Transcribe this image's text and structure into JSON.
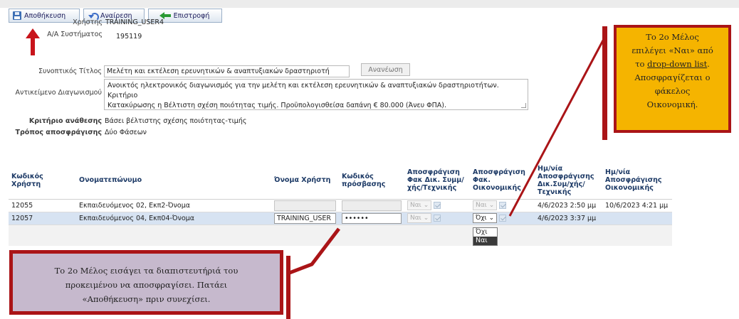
{
  "toolbar": {
    "save_label": "Αποθήκευση",
    "cancel_label": "Αναίρεση",
    "back_label": "Επιστροφή"
  },
  "form": {
    "user_label": "Χρήστης",
    "user_value": "TRAINING_USER4",
    "system_no_label": "Α/Α Συστήματος",
    "system_no_value": "195119",
    "short_title_label": "Συνοπτικός Τίτλος",
    "short_title_value": "Μελέτη και εκτέλεση ερευνητικών & αναπτυξιακών δραστηριοτή",
    "refresh_label": "Ανανέωση",
    "subject_label": "Αντικείμενο Διαγωνισμού",
    "subject_line1": "Ανοικτός ηλεκτρονικός διαγωνισμός για την  μελέτη και εκτέλεση ερευνητικών & αναπτυξιακών δραστηριοτήτων. Κριτήριο",
    "subject_line2": "Κατακύρωσης η Βέλτιστη σχέση ποιότητας τιμής. Προϋπολογισθείσα δαπάνη € 80.000 (Άνευ ΦΠΑ).",
    "award_label": "Κριτήριο ανάθεσης",
    "award_value": "Βάσει βέλτιστης σχέσης ποιότητας-τιμής",
    "unseal_label": "Τρόπος αποσφράγισης",
    "unseal_value": "Δύο Φάσεων"
  },
  "table": {
    "headers": {
      "user_code": "Κωδικός Χρήστη",
      "fullname": "Ονοματεπώνυμο",
      "username": "Όνομα Χρήστη",
      "password": "Κωδικός πρόσβασης",
      "tech_unseal": "Αποσφράγιση Φακ Δικ. Συμμ/χής/Τεχνικής",
      "fin_unseal": "Αποσφράγιση Φακ. Οικονομικής",
      "tech_date": "Ημ/νία Αποσφράγισης Δικ.Συμ/χής/Τεχνικής",
      "fin_date": "Ημ/νία Αποσφράγισης Οικονομικής"
    },
    "rows": [
      {
        "user_code": "12055",
        "fullname": "Εκπαιδευόμενος 02, Εκπ2-Όνομα",
        "username": "",
        "password": "",
        "tech_select": "Ναι",
        "fin_select": "Ναι",
        "tech_date": "4/6/2023 2:50 μμ",
        "fin_date": "10/6/2023 4:21 μμ"
      },
      {
        "user_code": "12057",
        "fullname": "Εκπαιδευόμενος 04, Εκπ04-Όνομα",
        "username": "TRAINING_USER",
        "password": "••••••",
        "tech_select": "Ναι",
        "fin_select": "Όχι",
        "tech_date": "4/6/2023 3:37 μμ",
        "fin_date": ""
      }
    ],
    "dropdown_options": [
      "Όχι",
      "Ναι"
    ]
  },
  "callouts": {
    "right": {
      "line1": "Το 2ο Μέλος",
      "line2": "επιλέγει «Ναι» από",
      "line3_pre": "το ",
      "line3_link": "drop-down list",
      "line3_post": ".",
      "line4": "Αποσφραγίζεται ο",
      "line5": "φάκελος",
      "line6": "Οικονομική."
    },
    "left": {
      "line1": "Το 2ο Μέλος εισάγει τα διαπιστευτήριά του",
      "line2": "προκειμένου να αποσφραγίσει. Πατάει",
      "line3": "«Αποθήκευση» πριν συνεχίσει."
    }
  },
  "colors": {
    "callout_border": "#aa1417",
    "callout_right_fill": "#f5b400",
    "callout_left_fill": "#c6b9cd",
    "selected_row": "#d7e3f2",
    "header_text": "#1d3a66"
  }
}
